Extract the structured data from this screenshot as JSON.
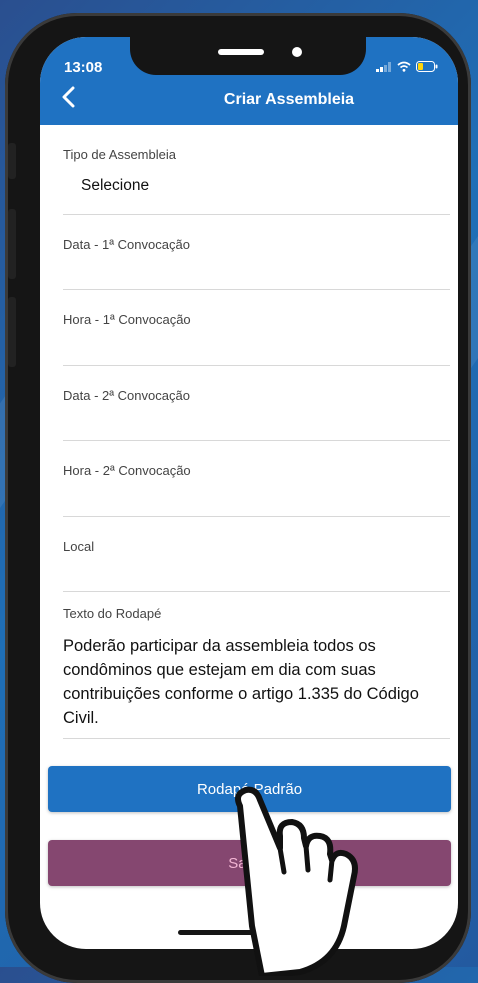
{
  "status_bar": {
    "time": "13:08"
  },
  "header": {
    "title": "Criar Assembleia",
    "back_icon": "chevron-left-icon"
  },
  "form": {
    "tipo": {
      "label": "Tipo de Assembleia",
      "value": "Selecione"
    },
    "data1": {
      "label": "Data - 1ª Convocação",
      "value": ""
    },
    "hora1": {
      "label": "Hora - 1ª Convocação",
      "value": ""
    },
    "data2": {
      "label": "Data - 2ª Convocação",
      "value": ""
    },
    "hora2": {
      "label": "Hora - 2ª Convocação",
      "value": ""
    },
    "local": {
      "label": "Local",
      "value": ""
    },
    "rodape": {
      "label": "Texto do Rodapé",
      "value": "Poderão participar da assembleia todos os condôminos que estejam em dia com suas contribuições conforme o artigo 1.335 do Código Civil."
    }
  },
  "buttons": {
    "rodape_padrao": "Rodapé Padrão",
    "salvar": "Salvar"
  },
  "colors": {
    "primary": "#1f72c2",
    "save": "#854770",
    "save_text": "#f3b6d4"
  },
  "icons": [
    "signal-icon",
    "wifi-icon",
    "battery-icon",
    "pointing-hand-icon"
  ]
}
